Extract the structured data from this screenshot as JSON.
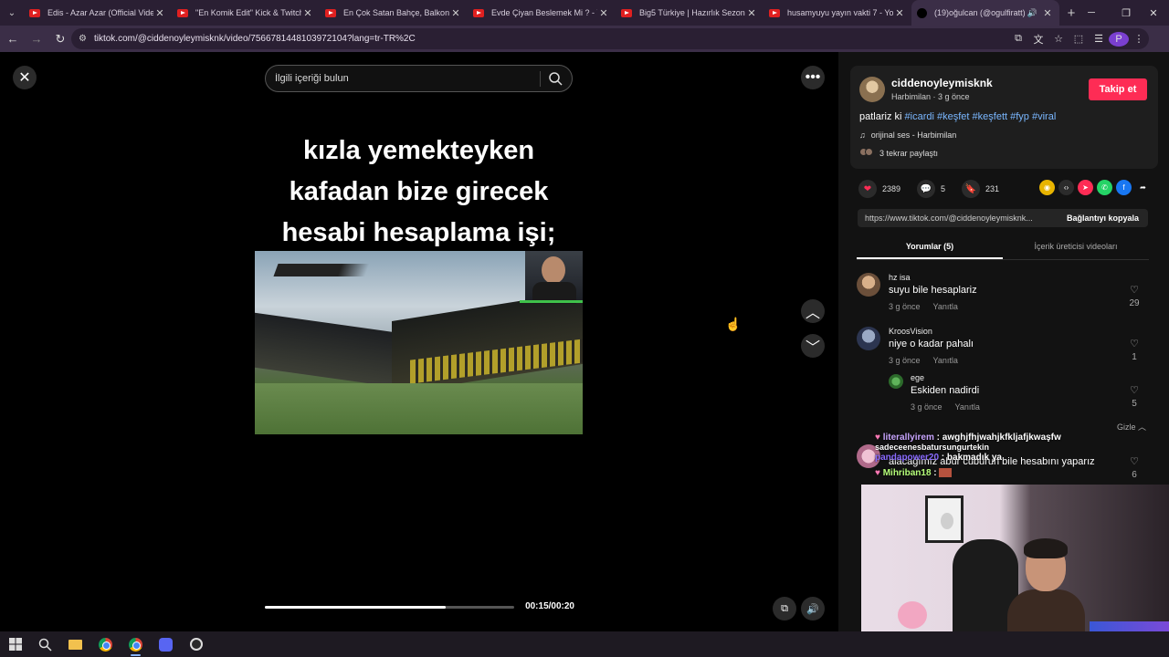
{
  "browser": {
    "tabs": [
      {
        "title": "Edis - Azar Azar (Official Video)",
        "icon": "youtube-icon"
      },
      {
        "title": "\"En Komik Edit\" Kick & Twitch Kl",
        "icon": "youtube-icon"
      },
      {
        "title": "En Çok Satan Bahçe, Balkon ve",
        "icon": "youtube-icon"
      },
      {
        "title": "Evde Çiyan Beslemek Mi ? - You",
        "icon": "youtube-icon"
      },
      {
        "title": "Big5 Türkiye | Hazırlık Sezonu 4",
        "icon": "youtube-icon"
      },
      {
        "title": "husamyuyu yayın vakti 7 - YouT",
        "icon": "youtube-icon"
      },
      {
        "title": "(19)oğulcan (@ogulfiratt) | Tik",
        "icon": "tiktok-icon",
        "active": true
      }
    ],
    "url": "tiktok.com/@ciddenoyleymisknk/video/7566781448103972104?lang=tr-TR%2C",
    "profile_initial": "P"
  },
  "video": {
    "search_placeholder": "İlgili içeriği bulun",
    "caption_lines": [
      "kızla yemekteyken",
      "kafadan bize girecek",
      "hesabi hesaplama işi;"
    ],
    "time": "00:15/00:20",
    "progress": 0.725
  },
  "post": {
    "username": "ciddenoyleymisknk",
    "author_name": "Harbimilan",
    "posted": "3 g önce",
    "follow_label": "Takip et",
    "desc_text": "patlariz ki",
    "hashtags": [
      "#icardi",
      "#keşfet",
      "#keşfett",
      "#fyp",
      "#viral"
    ],
    "music": "orijinal ses - Harbimilan",
    "reposts": "3 tekrar paylaştı",
    "likes": "2389",
    "comments": "5",
    "saves": "231",
    "link": "https://www.tiktok.com/@ciddenoyleymisknk...",
    "copy_label": "Bağlantıyı kopyala",
    "tab_comments": "Yorumlar (5)",
    "tab_creator": "İçerik üreticisi videoları",
    "hide_label": "Gizle"
  },
  "comments": [
    {
      "user": "hz isa",
      "text": "suyu bile hesaplariz",
      "time": "3 g önce",
      "reply": "Yanıtla",
      "likes": "29"
    },
    {
      "user": "KroosVision",
      "text": "niye o kadar pahalı",
      "time": "3 g önce",
      "reply": "Yanıtla",
      "likes": "1"
    },
    {
      "user": "ege",
      "text": "Eskiden nadirdi",
      "time": "3 g önce",
      "reply": "Yanıtla",
      "likes": "5"
    },
    {
      "user": "",
      "text": "alacağımız abur cuburun bile hesabını yaparız",
      "time": "",
      "reply": "",
      "likes": "6"
    }
  ],
  "chat_overlay": [
    {
      "user": "literallyirem",
      "message": "awghjfhjwahjkfkljafjkwaşfw",
      "color": "#c9a6ff"
    },
    {
      "user": "sadeceenesbatursungurtekin",
      "message": "",
      "color": "#ffffff"
    },
    {
      "user": "pandapower20",
      "message": "bakmadık ya",
      "color": "#8a6bff"
    },
    {
      "user": "Mihriban18",
      "message": "",
      "color": "#b6ff7a"
    }
  ],
  "colors": {
    "accent": "#fe2c55",
    "hashtag": "#7ab7ff",
    "background": "#000000",
    "panel": "#121212"
  }
}
